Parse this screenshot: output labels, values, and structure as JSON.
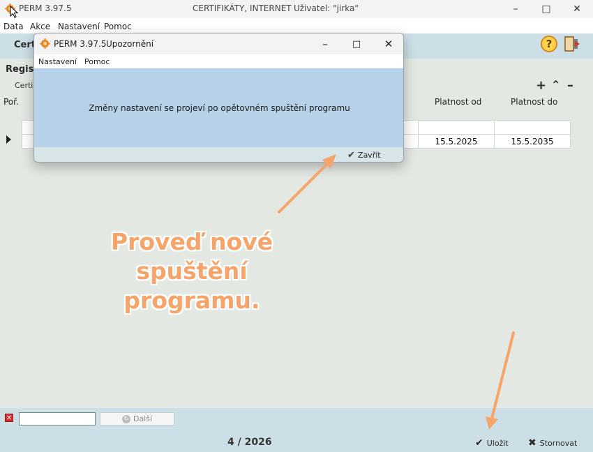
{
  "window": {
    "app_name": "PERM 3.97.5",
    "center_text": "CERTIFIKÁTY, INTERNET",
    "user_text": "Uživatel: \"jirka\""
  },
  "menu": [
    "Data",
    "Akce",
    "Nastavení",
    "Pomoc"
  ],
  "toolbar": {
    "heading": "Certi"
  },
  "content": {
    "reg_heading": "Regist",
    "cert_tab": "Certi",
    "table": {
      "headers": {
        "col1": "Poř.",
        "platnost_od": "Platnost od",
        "platnost_do": "Platnost do"
      },
      "rows": [
        {
          "platnost_od": "",
          "platnost_do": ""
        },
        {
          "platnost_od": "15.5.2025",
          "platnost_do": "15.5.2035"
        }
      ]
    }
  },
  "search": {
    "next_label": "Další",
    "value": ""
  },
  "footer": {
    "period": "4 / 2026",
    "save_label": "Uložit",
    "cancel_label": "Stornovat"
  },
  "dialog": {
    "app_name": "PERM 3.97.5",
    "caption": "Upozornění",
    "menu": [
      "Nastavení",
      "Pomoc"
    ],
    "message": "Změny nastavení se projeví po opětovném spuštění programu",
    "close_label": "Zavřít"
  },
  "annotation": {
    "line1": "Proveď nové spuštění",
    "line2": "programu.",
    "color": "#f5a46a"
  },
  "icons": [
    "app-gear-icon",
    "help-icon",
    "exit-door-icon",
    "add-icon",
    "up-icon",
    "remove-icon",
    "check-icon",
    "close-x-icon"
  ]
}
